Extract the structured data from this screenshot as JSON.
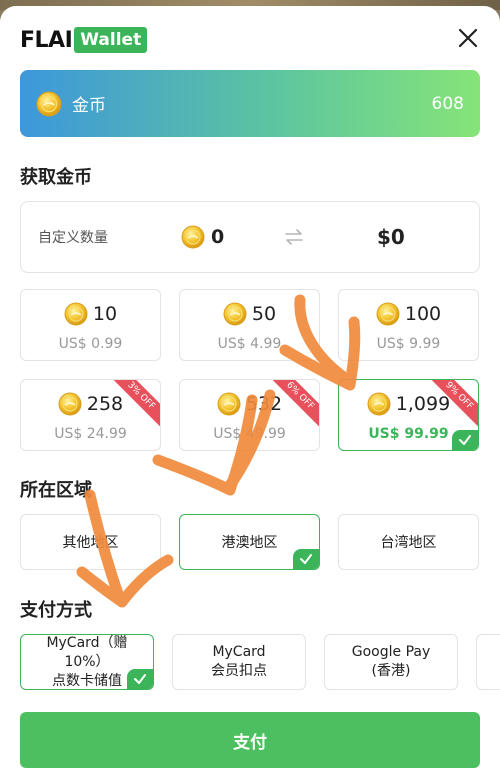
{
  "header": {
    "brand": "FLAI",
    "badge": "Wallet"
  },
  "balance": {
    "label": "金币",
    "value": "608"
  },
  "sections": {
    "get_coins": "获取金币",
    "region": "所在区域",
    "payment": "支付方式"
  },
  "custom": {
    "label": "自定义数量",
    "coins": "0",
    "usd": "$0"
  },
  "packages": [
    {
      "coins": "10",
      "price": "US$ 0.99",
      "discount": ""
    },
    {
      "coins": "50",
      "price": "US$ 4.99",
      "discount": ""
    },
    {
      "coins": "100",
      "price": "US$ 9.99",
      "discount": ""
    },
    {
      "coins": "258",
      "price": "US$ 24.99",
      "discount": "3% OFF"
    },
    {
      "coins": "532",
      "price": "US$ 49.99",
      "discount": "6% OFF"
    },
    {
      "coins": "1,099",
      "price": "US$ 99.99",
      "discount": "9% OFF"
    }
  ],
  "regions": [
    "其他地区",
    "港澳地区",
    "台湾地区"
  ],
  "payment_methods": [
    {
      "line1": "MyCard（赠",
      "line2": "10%）",
      "line3": "点数卡储值"
    },
    {
      "line1": "MyCard",
      "line2": "会员扣点"
    },
    {
      "line1": "Google Pay",
      "line2": "(香港)"
    }
  ],
  "pay_button": "支付",
  "colors": {
    "accent": "#3cb55a",
    "ribbon": "#e8505b",
    "gradient_start": "#3d97db",
    "gradient_end": "#86e478",
    "annotation_arrow": "#f08a3c"
  }
}
